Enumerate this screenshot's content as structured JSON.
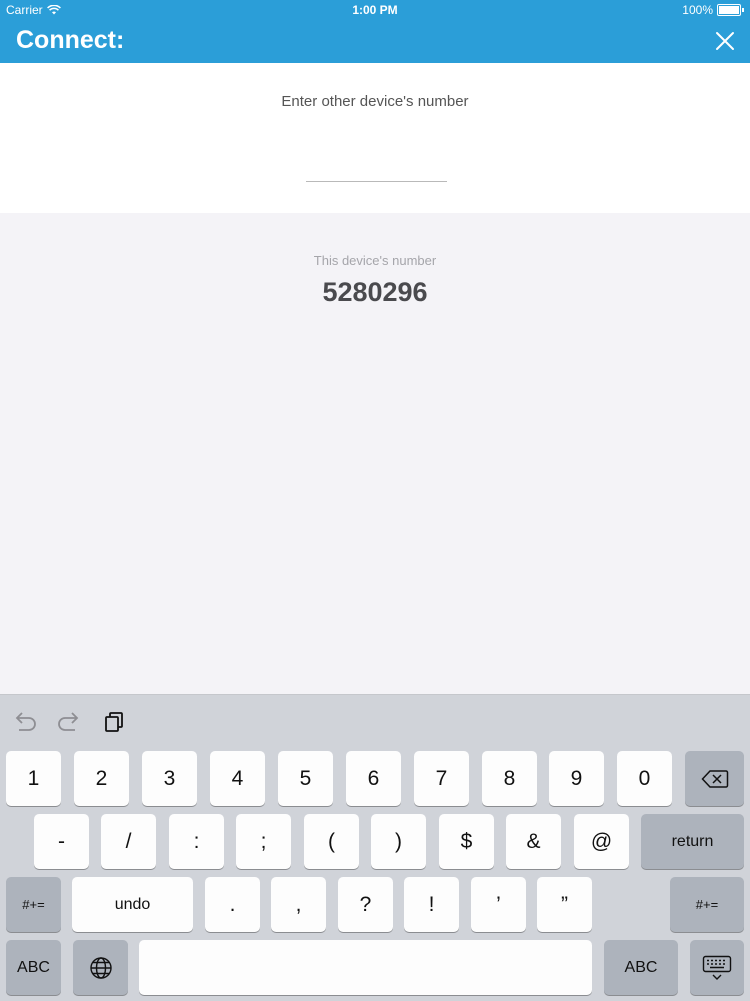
{
  "status": {
    "carrier": "Carrier",
    "time": "1:00 PM",
    "battery": "100%"
  },
  "nav": {
    "title": "Connect:",
    "close_icon": "close-icon"
  },
  "connect": {
    "input_label": "Enter other device's number",
    "input_value": "",
    "device_caption": "This device's number",
    "device_number": "5280296"
  },
  "colors": {
    "accent": "#2b9ed8",
    "background": "#f4f3f7"
  },
  "keyboard": {
    "toolbar": [
      "undo-icon",
      "redo-icon",
      "paste-icon"
    ],
    "row1": [
      "1",
      "2",
      "3",
      "4",
      "5",
      "6",
      "7",
      "8",
      "9",
      "0"
    ],
    "row2": [
      "-",
      "/",
      ":",
      ";",
      "(",
      ")",
      "$",
      "&",
      "@"
    ],
    "return_label": "return",
    "symbols_label": "#+=",
    "undo_label": "undo",
    "row3": [
      ".",
      ",",
      "?",
      "!",
      "’",
      "”"
    ],
    "abc_label": "ABC"
  }
}
